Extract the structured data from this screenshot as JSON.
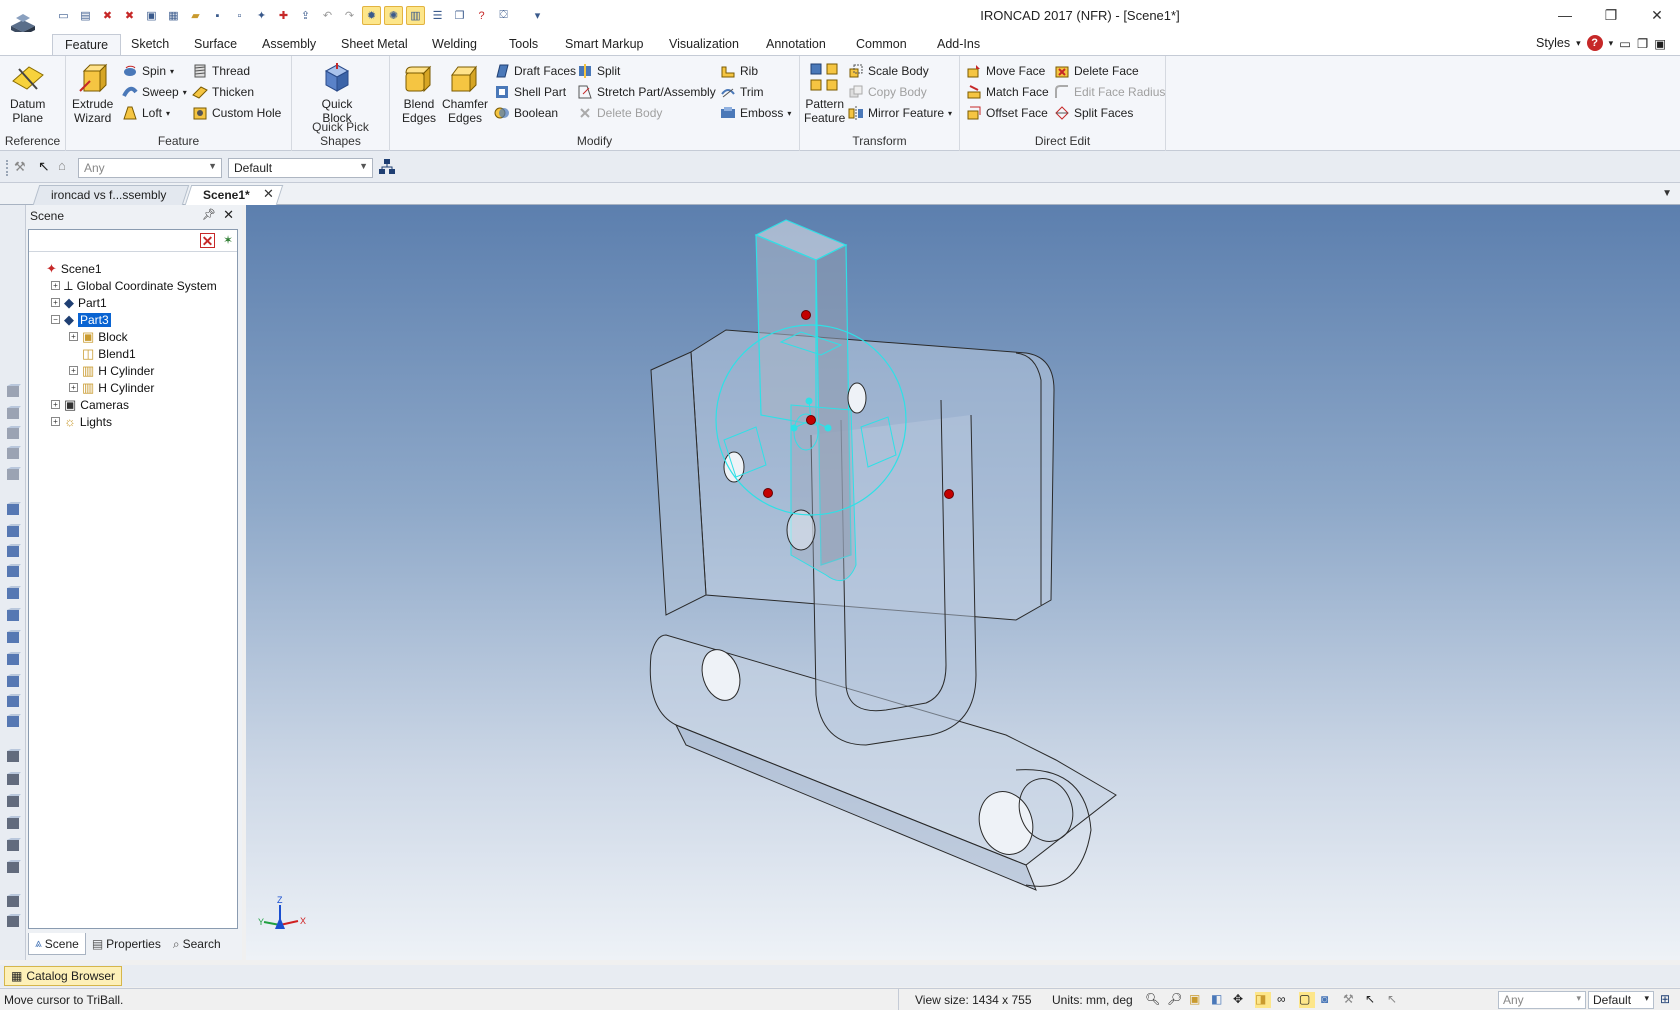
{
  "app": {
    "title": "IRONCAD 2017 (NFR) - [Scene1*]",
    "logo_icon": "ironcad-logo-icon"
  },
  "ribbon_tabs": [
    "Feature",
    "Sketch",
    "Surface",
    "Assembly",
    "Sheet Metal",
    "Welding",
    "Tools",
    "Smart Markup",
    "Visualization",
    "Annotation",
    "Common",
    "Add-Ins"
  ],
  "active_tab": "Feature",
  "styles_label": "Styles",
  "ribbon": {
    "reference": {
      "label": "Reference",
      "datum_plane": "Datum\nPlane"
    },
    "feature": {
      "label": "Feature",
      "extrude_wizard": "Extrude\nWizard",
      "spin": "Spin",
      "sweep": "Sweep",
      "loft": "Loft",
      "thread": "Thread",
      "thicken": "Thicken",
      "custom_hole": "Custom Hole"
    },
    "quick_pick": {
      "label": "Quick Pick Shapes",
      "quick_block": "Quick\nBlock"
    },
    "modify": {
      "label": "Modify",
      "blend_edges": "Blend\nEdges",
      "chamfer_edges": "Chamfer\nEdges",
      "draft_faces": "Draft Faces",
      "shell_part": "Shell Part",
      "boolean": "Boolean",
      "split": "Split",
      "stretch": "Stretch Part/Assembly",
      "delete_body": "Delete Body",
      "rib": "Rib",
      "trim": "Trim",
      "emboss": "Emboss"
    },
    "transform": {
      "label": "Transform",
      "pattern_feature": "Pattern\nFeature",
      "scale_body": "Scale Body",
      "copy_body": "Copy Body",
      "mirror_feature": "Mirror Feature"
    },
    "direct_edit": {
      "label": "Direct Edit",
      "move_face": "Move Face",
      "match_face": "Match Face",
      "offset_face": "Offset Face",
      "delete_face": "Delete Face",
      "edit_face_radius": "Edit Face Radius",
      "split_faces": "Split Faces"
    }
  },
  "toolbar2": {
    "filter_value": "Any",
    "style_value": "Default"
  },
  "doc_tabs": [
    {
      "label": "ironcad vs f...ssembly",
      "active": false
    },
    {
      "label": "Scene1*",
      "active": true
    }
  ],
  "scene_panel": {
    "title": "Scene",
    "tree": [
      {
        "label": "Scene1",
        "level": 0,
        "expander": "",
        "icon": "scene-icon",
        "selected": false
      },
      {
        "label": "Global Coordinate System",
        "level": 1,
        "expander": "+",
        "icon": "coordinate-system-icon",
        "selected": false
      },
      {
        "label": "Part1",
        "level": 1,
        "expander": "+",
        "icon": "part-icon",
        "selected": false
      },
      {
        "label": "Part3",
        "level": 1,
        "expander": "−",
        "icon": "part-icon",
        "selected": true
      },
      {
        "label": "Block",
        "level": 2,
        "expander": "+",
        "icon": "block-feature-icon",
        "selected": false
      },
      {
        "label": "Blend1",
        "level": 2,
        "expander": "",
        "icon": "blend-feature-icon",
        "selected": false
      },
      {
        "label": "H Cylinder",
        "level": 2,
        "expander": "+",
        "icon": "cylinder-feature-icon",
        "selected": false
      },
      {
        "label": "H Cylinder",
        "level": 2,
        "expander": "+",
        "icon": "cylinder-feature-icon",
        "selected": false
      },
      {
        "label": "Cameras",
        "level": 1,
        "expander": "+",
        "icon": "camera-icon",
        "selected": false
      },
      {
        "label": "Lights",
        "level": 1,
        "expander": "+",
        "icon": "light-icon",
        "selected": false
      }
    ],
    "tabs": [
      "Scene",
      "Properties",
      "Search"
    ]
  },
  "viewport": {
    "triad": {
      "x": "X",
      "y": "Y",
      "z": "Z"
    }
  },
  "catalog_browser": "Catalog Browser",
  "status": {
    "message": "Move cursor to TriBall.",
    "view_size": "View size: 1434 x  755",
    "units": "Units: mm, deg",
    "filter": "Any",
    "style": "Default"
  },
  "colors": {
    "accent": "#0a64d2",
    "selection_cyan": "#2fe0e6",
    "handle_red": "#c40000",
    "triad_blue": "#1a4fd0",
    "triad_red": "#d02020",
    "triad_green": "#20a040"
  }
}
